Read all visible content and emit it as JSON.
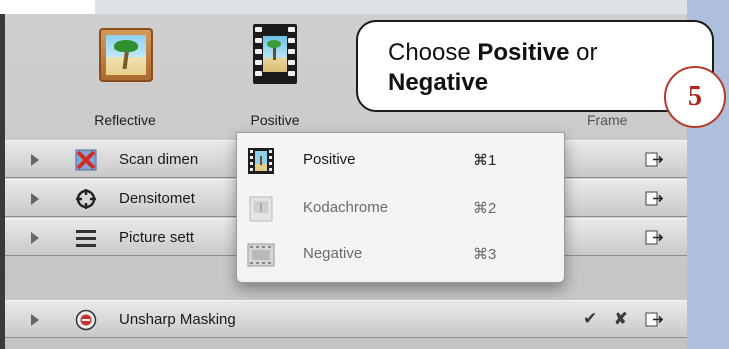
{
  "toolbar": {
    "items": [
      {
        "label": "Reflective",
        "icon": "reflective-photo-icon"
      },
      {
        "label": "Positive",
        "icon": "film-strip-icon"
      }
    ],
    "hidden_label": "Frame"
  },
  "callout": {
    "line1_prefix": "Choose ",
    "line1_bold": "Positive",
    "line1_suffix": " or",
    "line2_bold": "Negative",
    "step_number": "5"
  },
  "panels": [
    {
      "label": "Scan dimen",
      "icon": "scan-dimensions-icon",
      "export_icon": "export-icon"
    },
    {
      "label": "Densitomet",
      "icon": "densitometer-icon",
      "export_icon": "export-icon"
    },
    {
      "label": "Picture sett",
      "icon": "picture-settings-icon",
      "export_icon": "export-icon"
    },
    {
      "label": "Unsharp Masking",
      "icon": "unsharp-masking-icon",
      "check": "✔",
      "close": "✘",
      "export_icon": "export-icon"
    }
  ],
  "menu": {
    "items": [
      {
        "label": "Positive",
        "shortcut": "⌘1",
        "icon": "positive-film-icon"
      },
      {
        "label": "Kodachrome",
        "shortcut": "⌘2",
        "icon": "kodachrome-icon"
      },
      {
        "label": "Negative",
        "shortcut": "⌘3",
        "icon": "negative-film-icon"
      }
    ]
  },
  "colors": {
    "accent_badge": "#a8281b",
    "side_bar": "#aebfdc"
  }
}
